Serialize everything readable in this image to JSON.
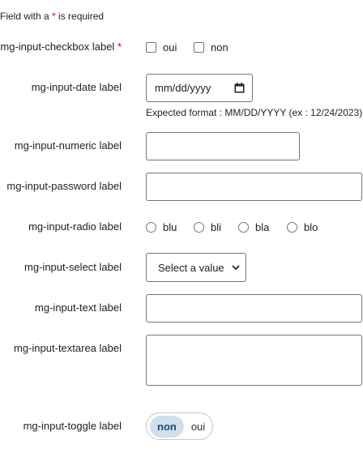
{
  "form": {
    "required_note": {
      "prefix": "Field with a ",
      "star": "*",
      "suffix": " is required"
    },
    "checkbox": {
      "label": "mg-input-checkbox label",
      "star": "*",
      "options": [
        "oui",
        "non"
      ]
    },
    "date": {
      "label": "mg-input-date label",
      "placeholder": "mm/dd/yyyy",
      "hint": "Expected format : MM/DD/YYYY (ex : 12/24/2023)"
    },
    "numeric": {
      "label": "mg-input-numeric label",
      "value": ""
    },
    "password": {
      "label": "mg-input-password label",
      "value": ""
    },
    "radio": {
      "label": "mg-input-radio label",
      "options": [
        "blu",
        "bli",
        "bla",
        "blo"
      ]
    },
    "select": {
      "label": "mg-input-select label",
      "value": "Select a value"
    },
    "text": {
      "label": "mg-input-text label",
      "value": ""
    },
    "textarea": {
      "label": "mg-input-textarea label",
      "value": ""
    },
    "toggle": {
      "label": "mg-input-toggle label",
      "selected": "non",
      "other": "oui"
    }
  },
  "icons": {
    "calendar": "calendar-icon",
    "select_arrow": "chevron-down-icon"
  },
  "colors": {
    "required_star": "#d40000",
    "toggle_active_bg": "#cfe0ee",
    "toggle_active_text": "#1a4a72"
  }
}
